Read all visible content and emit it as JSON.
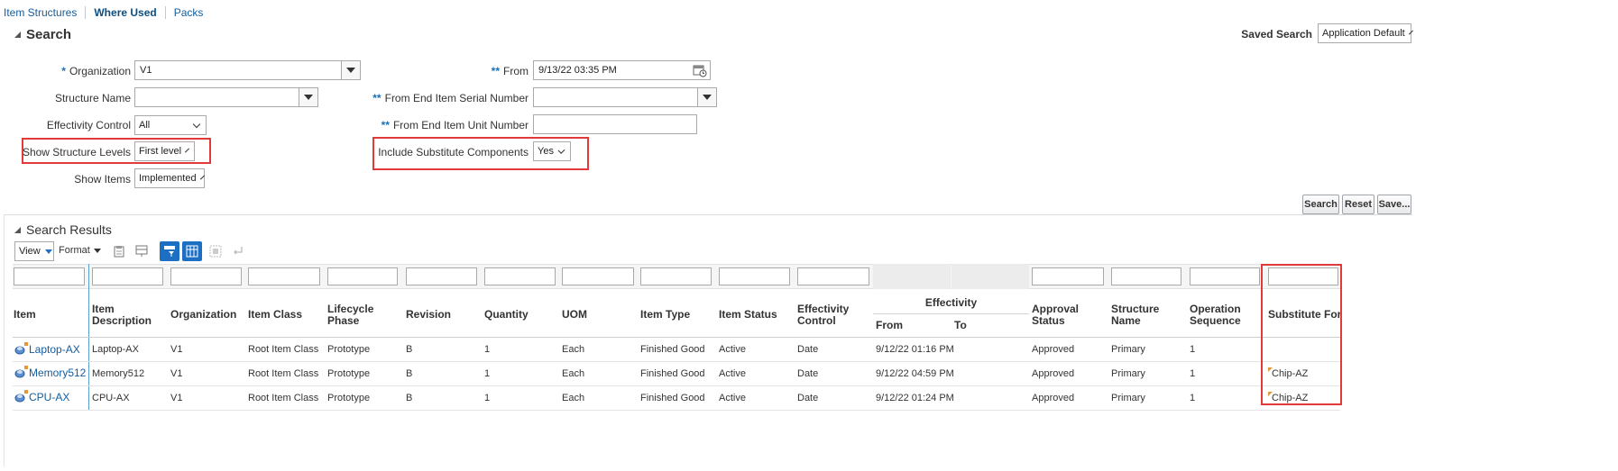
{
  "tabs": [
    {
      "label": "Item Structures",
      "active": false
    },
    {
      "label": "Where Used",
      "active": true
    },
    {
      "label": "Packs",
      "active": false
    }
  ],
  "search": {
    "title": "Search",
    "saved_search_label": "Saved Search",
    "saved_search_value": "Application Default",
    "organization": {
      "required_mark": "*",
      "label": "Organization",
      "value": "V1"
    },
    "structure_name": {
      "label": "Structure Name",
      "value": ""
    },
    "effectivity_control": {
      "label": "Effectivity Control",
      "value": "All"
    },
    "show_structure_levels": {
      "label": "Show Structure Levels",
      "value": "First level"
    },
    "show_items": {
      "label": "Show Items",
      "value": "Implemented"
    },
    "from": {
      "required_mark": "**",
      "label": "From",
      "value": "9/13/22 03:35 PM"
    },
    "from_serial": {
      "required_mark": "**",
      "label": "From End Item Serial Number",
      "value": ""
    },
    "from_unit": {
      "required_mark": "**",
      "label": "From End Item Unit Number",
      "value": ""
    },
    "include_substitute": {
      "label": "Include Substitute Components",
      "value": "Yes"
    },
    "buttons": {
      "search": "Search",
      "reset": "Reset",
      "save": "Save..."
    }
  },
  "results": {
    "title": "Search Results",
    "view_label": "View",
    "format_label": "Format",
    "columns": {
      "item": "Item",
      "item_description": "Item Description",
      "organization": "Organization",
      "item_class": "Item Class",
      "lifecycle_phase": "Lifecycle Phase",
      "revision": "Revision",
      "quantity": "Quantity",
      "uom": "UOM",
      "item_type": "Item Type",
      "item_status": "Item Status",
      "effectivity_control": "Effectivity Control",
      "effectivity": "Effectivity",
      "eff_from": "From",
      "eff_to": "To",
      "approval_status": "Approval Status",
      "structure_name": "Structure Name",
      "operation_sequence": "Operation Sequence",
      "substitute_for": "Substitute For"
    },
    "rows": [
      {
        "item": "Laptop-AX",
        "description": "Laptop-AX",
        "organization": "V1",
        "item_class": "Root Item Class",
        "lifecycle_phase": "Prototype",
        "revision": "B",
        "quantity": "1",
        "uom": "Each",
        "item_type": "Finished Good",
        "item_status": "Active",
        "effectivity_control": "Date",
        "eff_from": "9/12/22 01:16 PM",
        "eff_to": "",
        "approval_status": "Approved",
        "structure_name": "Primary",
        "operation_sequence": "1",
        "substitute_for": ""
      },
      {
        "item": "Memory512",
        "description": "Memory512",
        "organization": "V1",
        "item_class": "Root Item Class",
        "lifecycle_phase": "Prototype",
        "revision": "B",
        "quantity": "1",
        "uom": "Each",
        "item_type": "Finished Good",
        "item_status": "Active",
        "effectivity_control": "Date",
        "eff_from": "9/12/22 04:59 PM",
        "eff_to": "",
        "approval_status": "Approved",
        "structure_name": "Primary",
        "operation_sequence": "1",
        "substitute_for": "Chip-AZ"
      },
      {
        "item": "CPU-AX",
        "description": "CPU-AX",
        "organization": "V1",
        "item_class": "Root Item Class",
        "lifecycle_phase": "Prototype",
        "revision": "B",
        "quantity": "1",
        "uom": "Each",
        "item_type": "Finished Good",
        "item_status": "Active",
        "effectivity_control": "Date",
        "eff_from": "9/12/22 01:24 PM",
        "eff_to": "",
        "approval_status": "Approved",
        "structure_name": "Primary",
        "operation_sequence": "1",
        "substitute_for": "Chip-AZ"
      }
    ]
  },
  "colors": {
    "link": "#145c9e",
    "highlight": "#e03a3a",
    "accent": "#1d6fc4"
  },
  "icons": [
    "calendar-icon",
    "item-structure-icon",
    "detach-icon",
    "freeze-icon",
    "wrap-icon",
    "export-icon",
    "query-by-example-icon",
    "columns-icon"
  ]
}
